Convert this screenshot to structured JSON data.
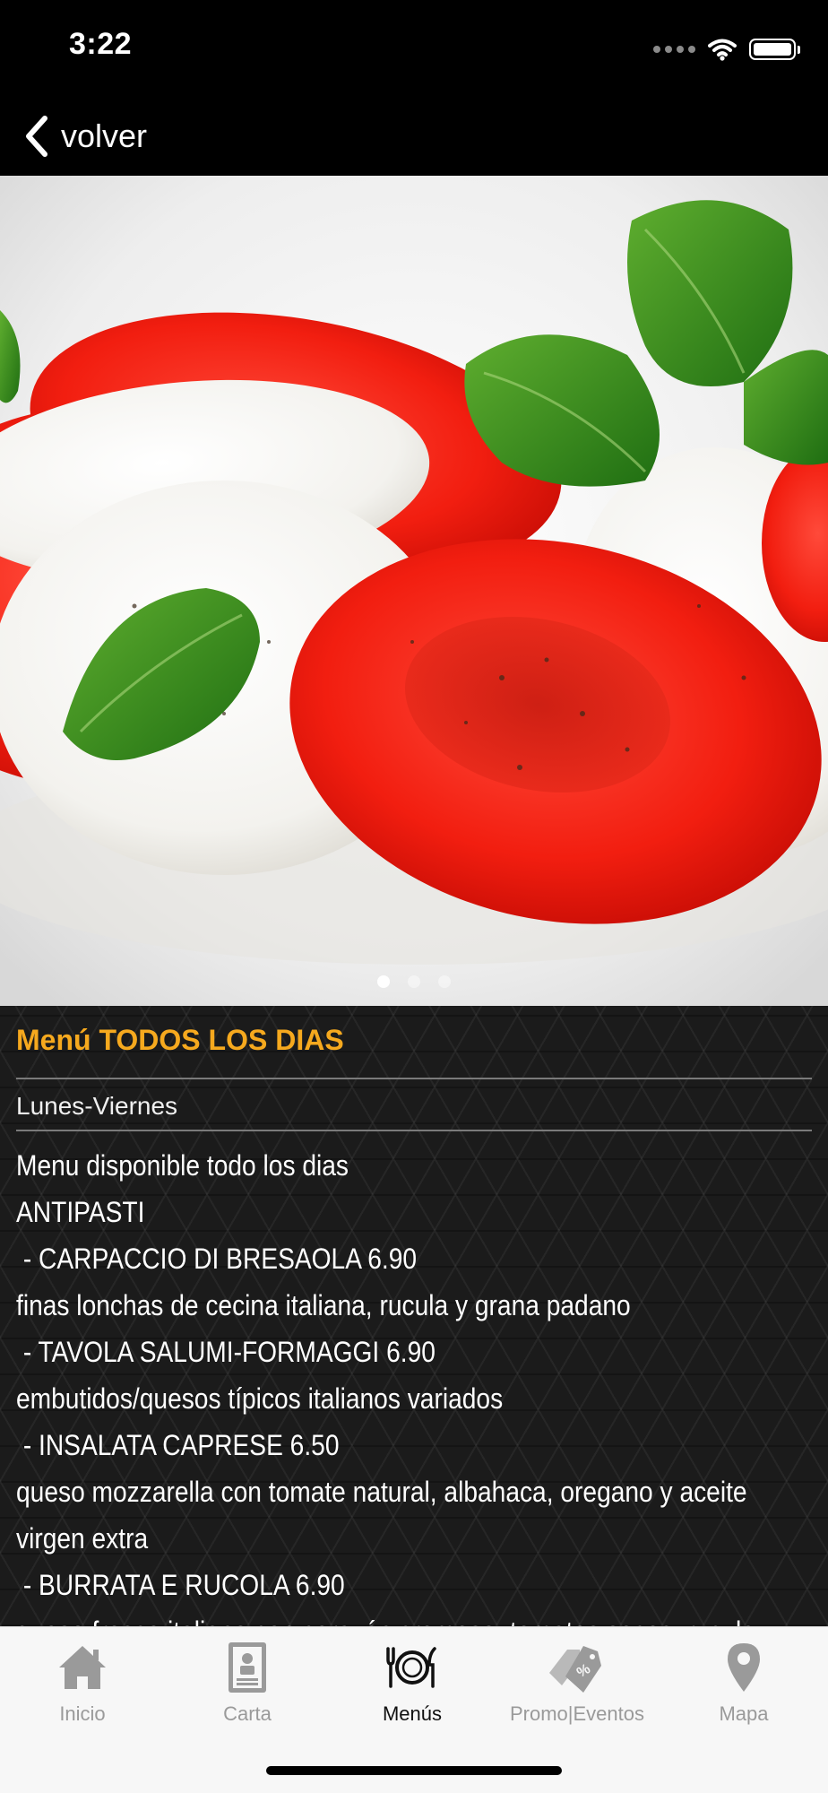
{
  "status_bar": {
    "time": "3:22"
  },
  "nav": {
    "back_label": "volver",
    "back_icon": "chevron-left-icon"
  },
  "hero": {
    "image_subject": "caprese-salad-photo",
    "page_count": 3,
    "current_page": 1
  },
  "menu": {
    "title": "Menú TODOS LOS DIAS",
    "subtitle": "Lunes-Viernes",
    "lines": [
      "Menu disponible todo los dias",
      "ANTIPASTI",
      " - CARPACCIO DI BRESAOLA 6.90",
      "finas lonchas de cecina italiana, rucula y grana padano",
      " - TAVOLA SALUMI-FORMAGGI 6.90",
      "embutidos/quesos típicos italianos variados",
      " - INSALATA CAPRESE 6.50",
      "queso mozzarella con tomate natural, albahaca, oregano y aceite",
      "virgen extra",
      " - BURRATA E RUCOLA 6.90",
      "queso fresco italiano con corazón cremoso, tomates secos, rucula y"
    ]
  },
  "tabs": [
    {
      "label": "Inicio",
      "icon": "house-icon",
      "active": false
    },
    {
      "label": "Carta",
      "icon": "menu-card-icon",
      "active": false
    },
    {
      "label": "Menús",
      "icon": "cutlery-plate-icon",
      "active": true
    },
    {
      "label": "Promo|Eventos",
      "icon": "price-tags-icon",
      "active": false
    },
    {
      "label": "Mapa",
      "icon": "map-pin-icon",
      "active": false
    }
  ],
  "colors": {
    "accent_title": "#f6a91e",
    "tab_inactive": "#9a9a9a",
    "tab_active": "#111111",
    "background": "#1b1b1b"
  }
}
